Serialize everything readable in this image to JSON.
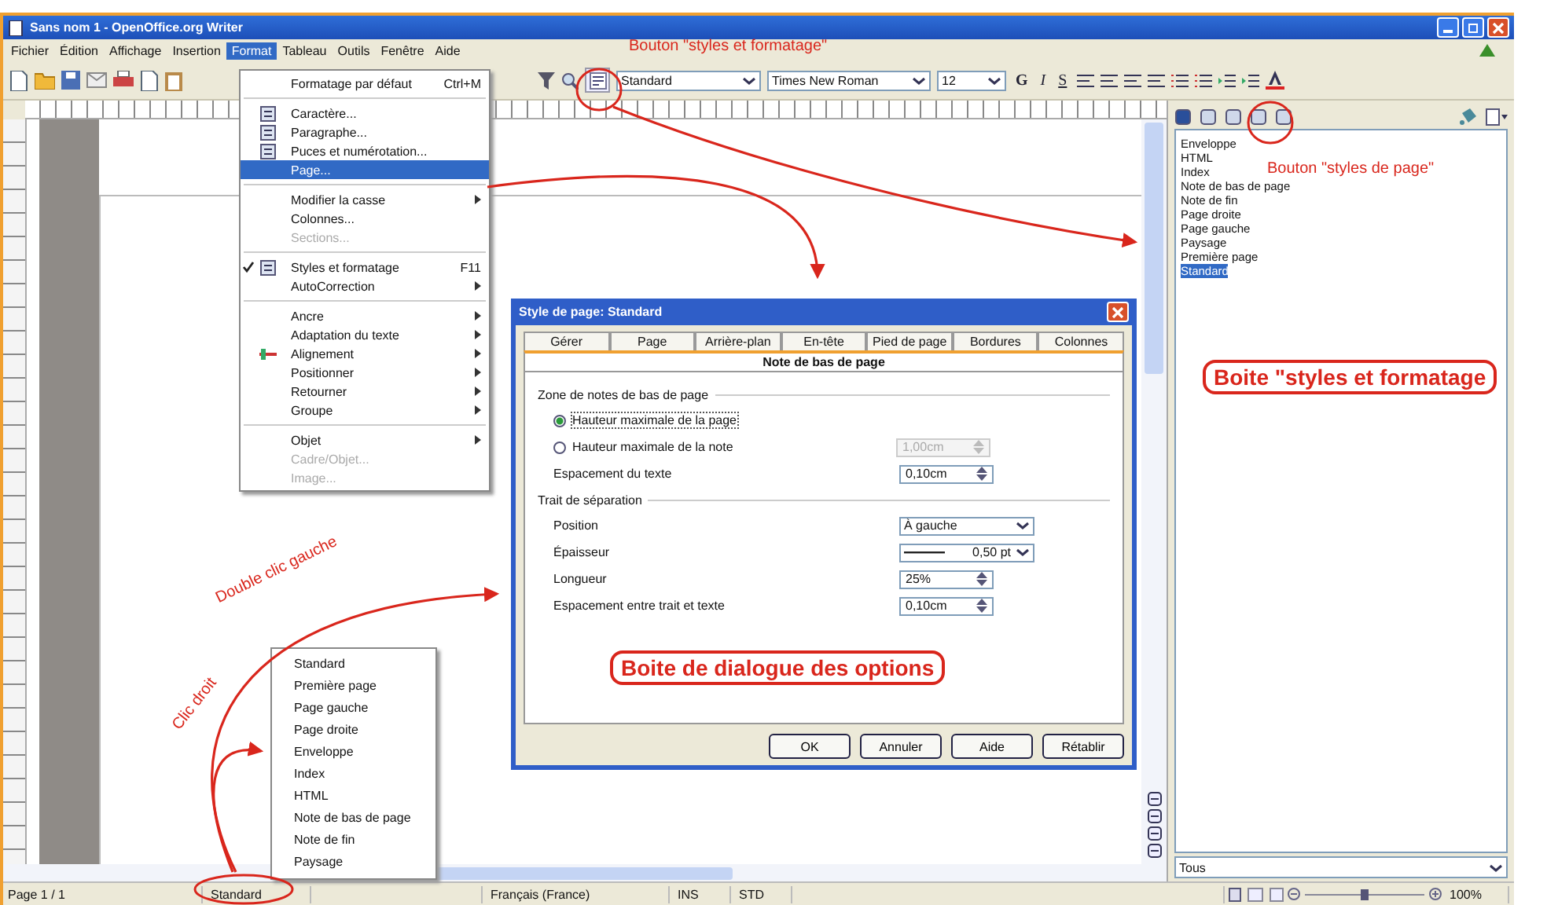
{
  "window": {
    "title": "Sans nom 1 - OpenOffice.org Writer"
  },
  "menu_bar": [
    {
      "label": "Fichier",
      "selected": false
    },
    {
      "label": "Édition",
      "selected": false
    },
    {
      "label": "Affichage",
      "selected": false
    },
    {
      "label": "Insertion",
      "selected": false
    },
    {
      "label": "Format",
      "selected": true
    },
    {
      "label": "Tableau",
      "selected": false
    },
    {
      "label": "Outils",
      "selected": false
    },
    {
      "label": "Fenêtre",
      "selected": false
    },
    {
      "label": "Aide",
      "selected": false
    }
  ],
  "toolbar": {
    "paragraph_style": "Standard",
    "font": "Times New Roman",
    "size": "12",
    "format_buttons": [
      "G",
      "I",
      "S"
    ]
  },
  "format_menu": {
    "groups": [
      {
        "items": [
          {
            "label": "Formatage par défaut",
            "shortcut": "Ctrl+M",
            "submenu": false,
            "checked": false,
            "disabled": false,
            "selected": false
          }
        ]
      },
      {
        "items": [
          {
            "label": "Caractère...",
            "submenu": false,
            "checked": false,
            "disabled": false,
            "selected": false
          },
          {
            "label": "Paragraphe...",
            "submenu": false,
            "checked": false,
            "disabled": false,
            "selected": false
          },
          {
            "label": "Puces et numérotation...",
            "submenu": false,
            "checked": false,
            "disabled": false,
            "selected": false
          },
          {
            "label": "Page...",
            "submenu": false,
            "checked": false,
            "disabled": false,
            "selected": true
          }
        ]
      },
      {
        "items": [
          {
            "label": "Modifier la casse",
            "submenu": true,
            "checked": false,
            "disabled": false,
            "selected": false
          },
          {
            "label": "Colonnes...",
            "submenu": false,
            "checked": false,
            "disabled": false,
            "selected": false
          },
          {
            "label": "Sections...",
            "submenu": false,
            "checked": false,
            "disabled": true,
            "selected": false
          }
        ]
      },
      {
        "items": [
          {
            "label": "Styles et formatage",
            "shortcut": "F11",
            "submenu": false,
            "checked": true,
            "disabled": false,
            "selected": false
          },
          {
            "label": "AutoCorrection",
            "submenu": true,
            "checked": false,
            "disabled": false,
            "selected": false
          }
        ]
      },
      {
        "items": [
          {
            "label": "Ancre",
            "submenu": true,
            "checked": false,
            "disabled": false,
            "selected": false
          },
          {
            "label": "Adaptation du texte",
            "submenu": true,
            "checked": false,
            "disabled": false,
            "selected": false
          },
          {
            "label": "Alignement",
            "submenu": true,
            "checked": false,
            "disabled": false,
            "selected": false
          },
          {
            "label": "Positionner",
            "submenu": true,
            "checked": false,
            "disabled": false,
            "selected": false
          },
          {
            "label": "Retourner",
            "submenu": true,
            "checked": false,
            "disabled": false,
            "selected": false
          },
          {
            "label": "Groupe",
            "submenu": true,
            "checked": false,
            "disabled": false,
            "selected": false
          }
        ]
      },
      {
        "items": [
          {
            "label": "Objet",
            "submenu": true,
            "checked": false,
            "disabled": false,
            "selected": false
          },
          {
            "label": "Cadre/Objet...",
            "submenu": false,
            "checked": false,
            "disabled": true,
            "selected": false
          },
          {
            "label": "Image...",
            "submenu": false,
            "checked": false,
            "disabled": true,
            "selected": false
          }
        ]
      }
    ]
  },
  "dialog": {
    "title": "Style de page: Standard",
    "tab_rows": [
      [
        {
          "label": "Gérer",
          "selected": false
        },
        {
          "label": "Page",
          "selected": false
        },
        {
          "label": "Arrière-plan",
          "selected": false
        },
        {
          "label": "En-tête",
          "selected": false
        },
        {
          "label": "Pied de page",
          "selected": false
        },
        {
          "label": "Bordures",
          "selected": false
        },
        {
          "label": "Colonnes",
          "selected": false
        }
      ],
      [
        {
          "label": "Note de bas de page",
          "selected": true
        }
      ]
    ],
    "sections": [
      {
        "title": "Zone de notes de bas de page",
        "rows": [
          {
            "kind": "radio",
            "label": "Hauteur maximale de la page",
            "selected": true
          },
          {
            "kind": "radio",
            "label": "Hauteur maximale de la note",
            "selected": false,
            "value": "1,00cm",
            "disabled": true
          },
          {
            "kind": "spin",
            "label": "Espacement du texte",
            "value": "0,10cm",
            "disabled": false
          }
        ]
      },
      {
        "title": "Trait de séparation",
        "rows": [
          {
            "kind": "select",
            "label": "Position",
            "value": "À gauche"
          },
          {
            "kind": "line-select",
            "label": "Épaisseur",
            "value": "0,50 pt"
          },
          {
            "kind": "spin",
            "label": "Longueur",
            "value": "25%",
            "disabled": false
          },
          {
            "kind": "spin",
            "label": "Espacement entre trait et texte",
            "value": "0,10cm",
            "disabled": false
          }
        ]
      }
    ],
    "buttons": [
      "OK",
      "Annuler",
      "Aide",
      "Rétablir"
    ]
  },
  "sidebar": {
    "items": [
      {
        "label": "Enveloppe",
        "selected": false
      },
      {
        "label": "HTML",
        "selected": false
      },
      {
        "label": "Index",
        "selected": false
      },
      {
        "label": "Note de bas de page",
        "selected": false
      },
      {
        "label": "Note de fin",
        "selected": false
      },
      {
        "label": "Page droite",
        "selected": false
      },
      {
        "label": "Page gauche",
        "selected": false
      },
      {
        "label": "Paysage",
        "selected": false
      },
      {
        "label": "Première page",
        "selected": false
      },
      {
        "label": "Standard",
        "selected": true
      }
    ],
    "filter": "Tous"
  },
  "context_menu": [
    "Standard",
    "Première page",
    "Page gauche",
    "Page droite",
    "Enveloppe",
    "Index",
    "HTML",
    "Note de bas de page",
    "Note de fin",
    "Paysage"
  ],
  "status_bar": {
    "page": "Page 1 / 1",
    "style": "Standard",
    "language": "Français (France)",
    "insert_mode": "INS",
    "selection_mode": "STD",
    "zoom": "100%",
    "zoom_slider": {
      "level": 0.5
    }
  },
  "annotations": [
    {
      "text": "Bouton \"styles et formatage\"",
      "kind": "caption"
    },
    {
      "text": "Bouton \"styles de page\"",
      "kind": "caption"
    },
    {
      "text": "Boite \"styles et formatage",
      "kind": "boxed"
    },
    {
      "text": "Boite de dialogue des options",
      "kind": "boxed"
    },
    {
      "text": "Double clic gauche",
      "kind": "caption"
    },
    {
      "text": "Clic droit",
      "kind": "caption"
    }
  ]
}
